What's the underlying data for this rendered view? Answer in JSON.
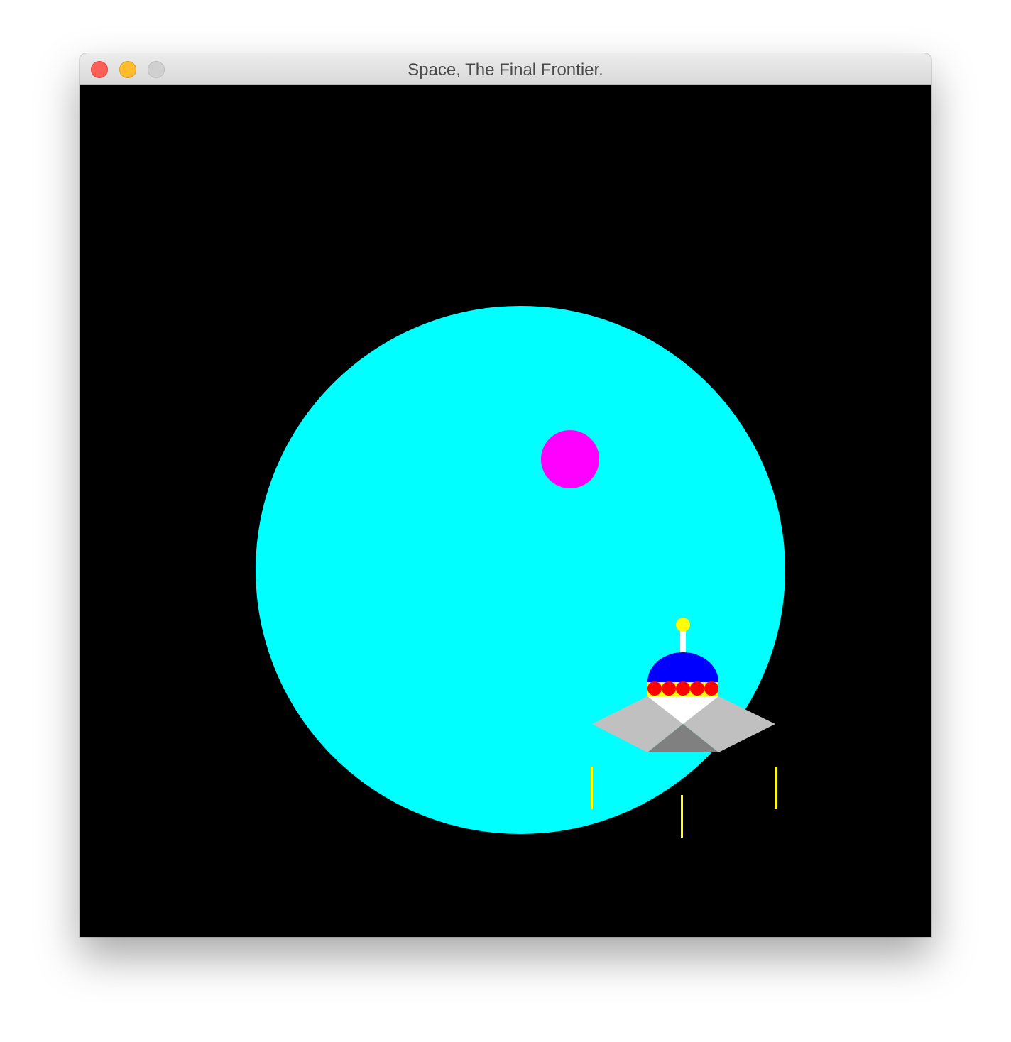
{
  "window": {
    "title": "Space, The Final Frontier.",
    "buttons": {
      "close": "close-button",
      "minimize": "minimize-button",
      "zoom": "zoom-button"
    }
  },
  "scene": {
    "background_color": "#000000",
    "planet_color": "#00ffff",
    "moon_color": "#ff00ff",
    "ship": {
      "antenna_light_color": "#ffff00",
      "antenna_color": "#ffffff",
      "dome_color": "#0000ff",
      "band_color": "#ffff00",
      "lights_color": "#ff0000",
      "body_color": "#ffffff",
      "wing_color": "#c0c0c0",
      "underside_color": "#808080",
      "beam_color": "#ffff00"
    }
  }
}
